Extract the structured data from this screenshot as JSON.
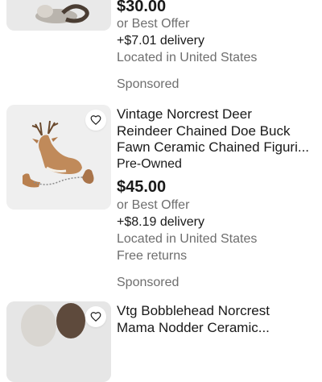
{
  "listings": [
    {
      "title_lines": [],
      "condition": "",
      "price": "$30.00",
      "offer": "or Best Offer",
      "delivery": "+$7.01 delivery",
      "location": "Located in United States",
      "returns": "",
      "footer_label": "Sponsored"
    },
    {
      "title_lines": [
        "Vintage Norcrest Deer",
        "Reindeer Chained Doe Buck",
        "Fawn Ceramic Chained Figuri..."
      ],
      "condition": "Pre-Owned",
      "price": "$45.00",
      "offer": "or Best Offer",
      "delivery": "+$8.19 delivery",
      "location": "Located in United States",
      "returns": "Free returns",
      "footer_label": "Sponsored"
    },
    {
      "title_lines": [
        "Vtg Bobblehead Norcrest",
        "Mama Nodder Ceramic..."
      ],
      "condition": "",
      "price": "",
      "offer": "",
      "delivery": "",
      "location": "",
      "returns": "",
      "footer_label": ""
    }
  ],
  "icons": {
    "watch": "heart-icon"
  },
  "colors": {
    "text": "#191919",
    "secondary": "#6e6e6e",
    "thumb_bg": "#ececec"
  }
}
